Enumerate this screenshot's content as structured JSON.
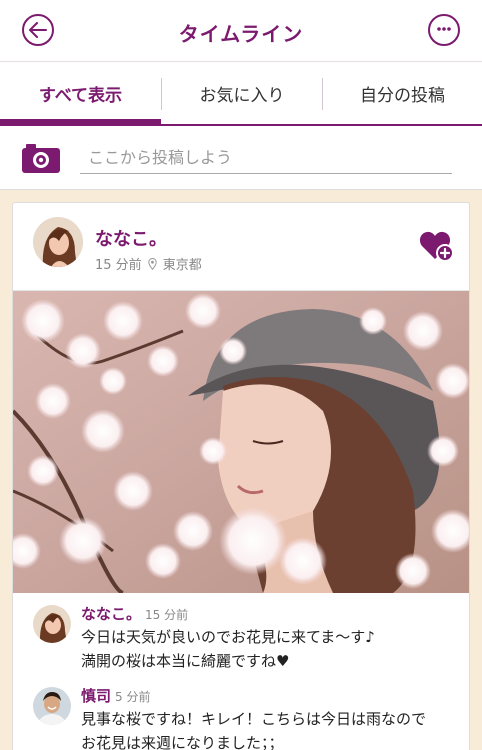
{
  "header": {
    "title": "タイムライン",
    "back_icon": "arrow-left-icon",
    "chat_icon": "chat-bubble-icon"
  },
  "tabs": [
    {
      "label": "すべて表示",
      "active": true
    },
    {
      "label": "お気に入り",
      "active": false
    },
    {
      "label": "自分の投稿",
      "active": false
    }
  ],
  "compose": {
    "placeholder": "ここから投稿しよう",
    "camera_icon": "camera-icon"
  },
  "post": {
    "author": "ななこ。",
    "time": "15 分前",
    "location": "東京都",
    "favorite_icon": "heart-plus-icon",
    "comments": [
      {
        "author": "ななこ。",
        "time": "15 分前",
        "lines": [
          "今日は天気が良いのでお花見に来てま〜す♪",
          "満開の桜は本当に綺麗ですね♥"
        ]
      },
      {
        "author": "慎司",
        "time": "5 分前",
        "lines": [
          "見事な桜ですね！キレイ！こちらは今日は雨なので",
          "お花見は来週になりました；；"
        ]
      }
    ]
  },
  "colors": {
    "brand": "#7b1a6e",
    "background": "#f8ecd8"
  }
}
